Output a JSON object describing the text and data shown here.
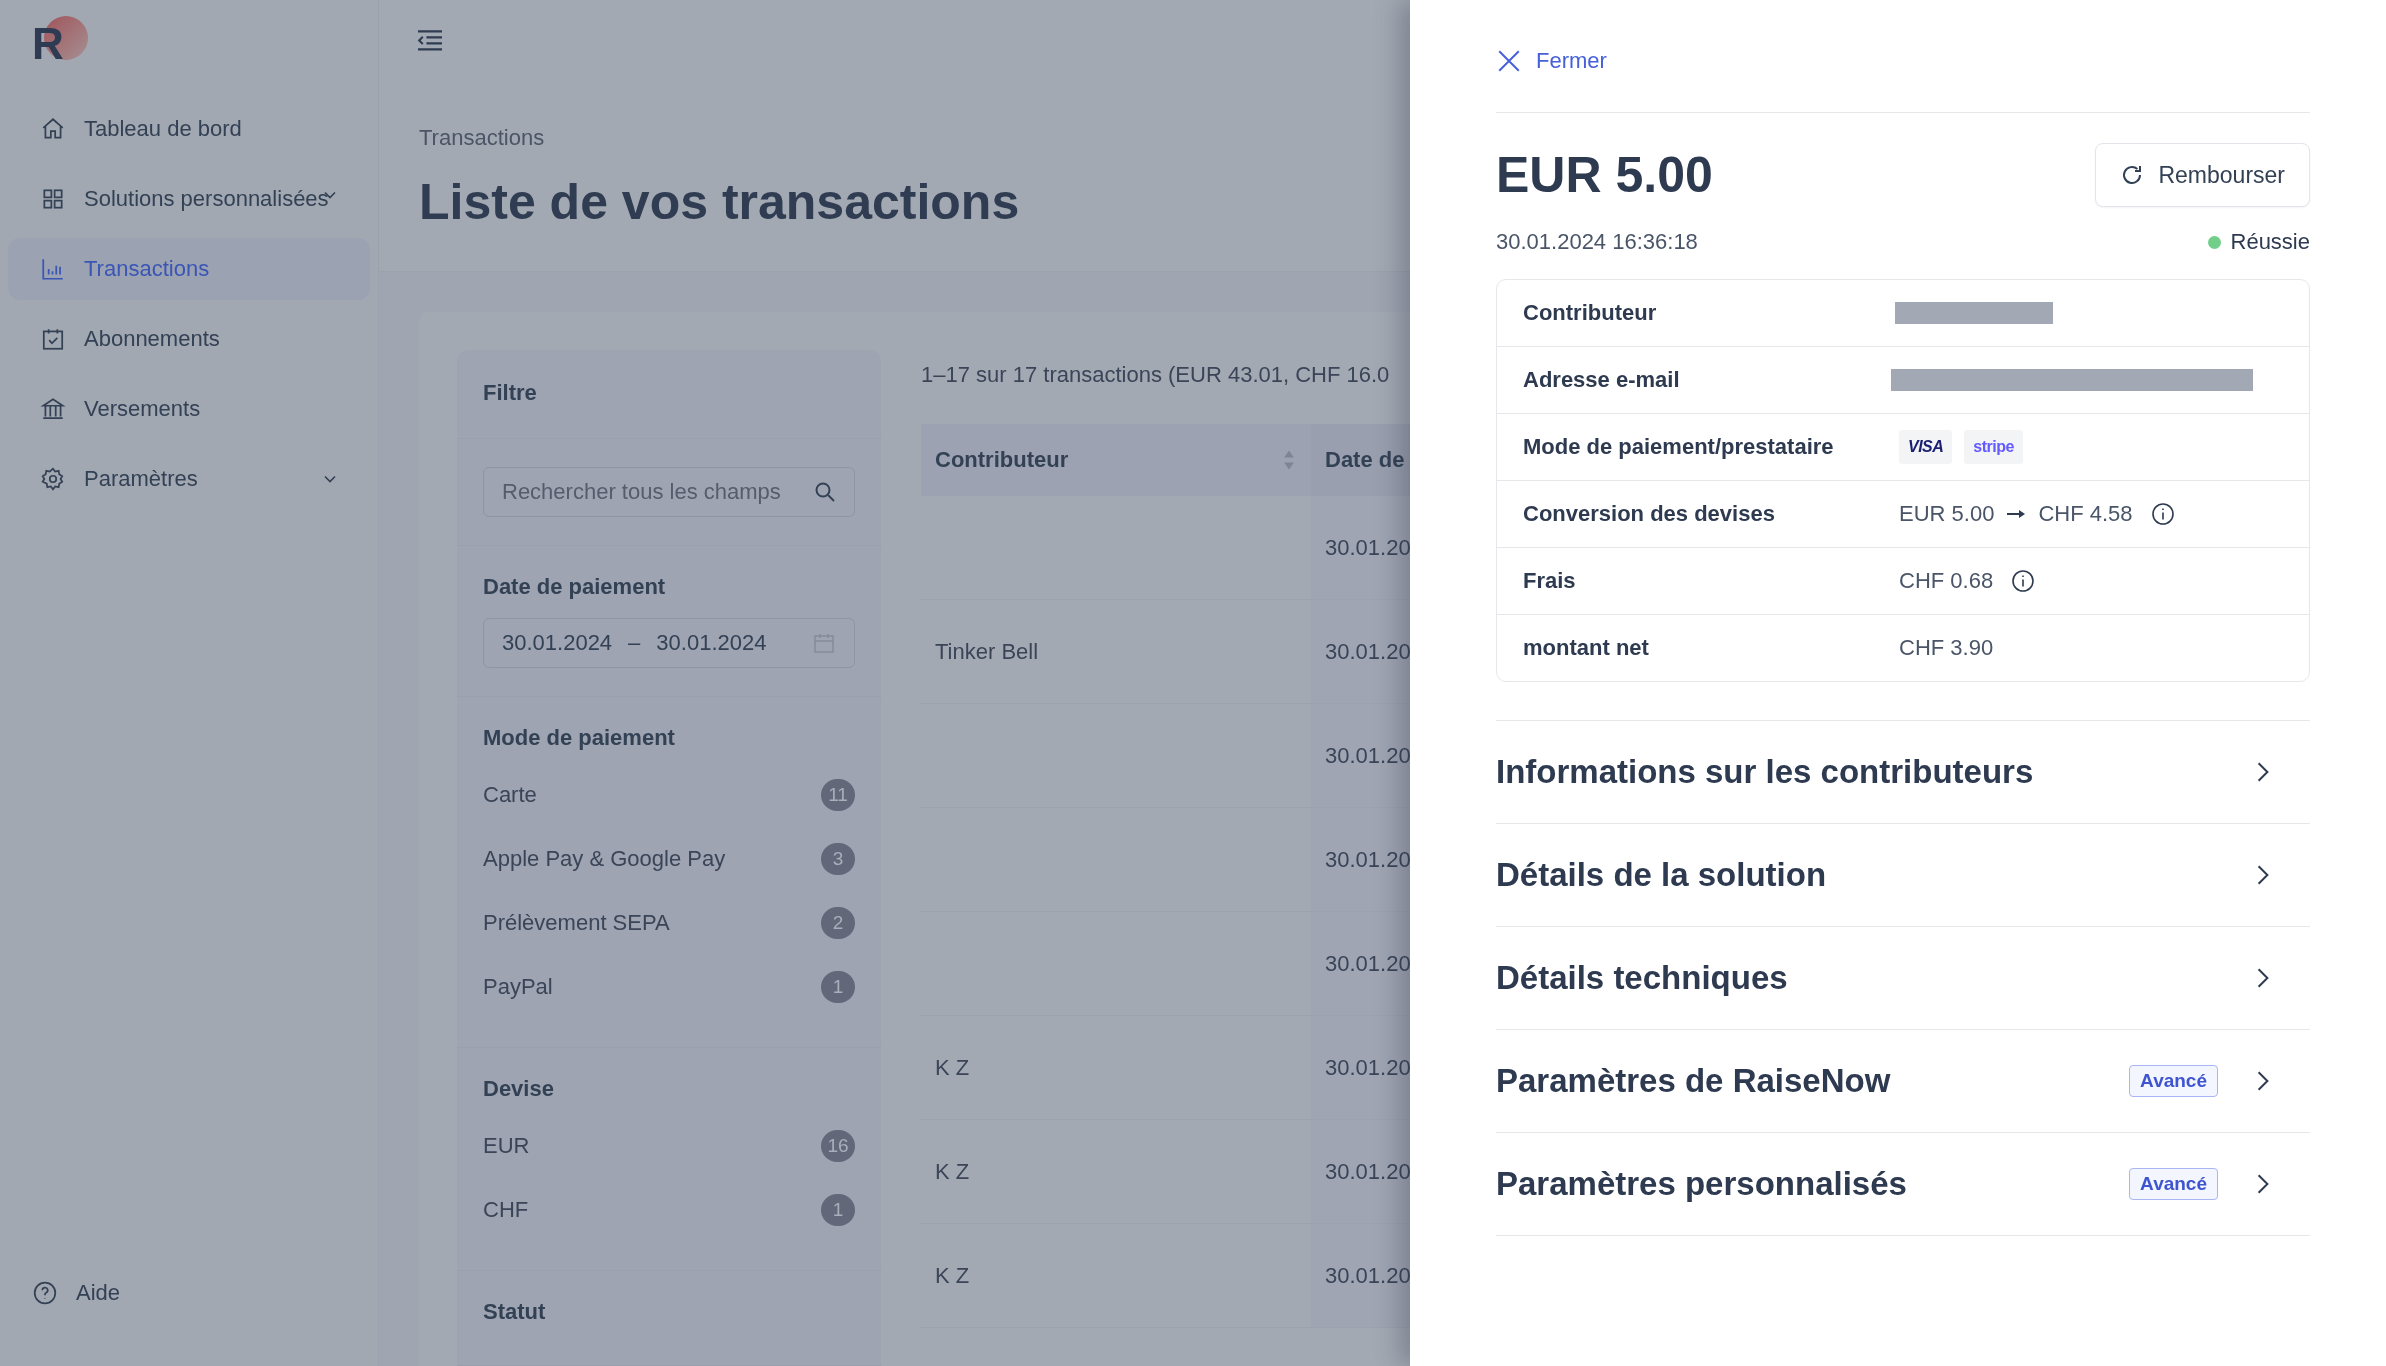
{
  "logo": {
    "letter": "R"
  },
  "sidebar": {
    "items": [
      {
        "label": "Tableau de bord",
        "selected": false,
        "expandable": false
      },
      {
        "label": "Solutions personnalisées",
        "selected": false,
        "expandable": true
      },
      {
        "label": "Transactions",
        "selected": true,
        "expandable": false
      },
      {
        "label": "Abonnements",
        "selected": false,
        "expandable": false
      },
      {
        "label": "Versements",
        "selected": false,
        "expandable": false
      },
      {
        "label": "Paramètres",
        "selected": false,
        "expandable": true
      }
    ],
    "help": "Aide"
  },
  "breadcrumb": "Transactions",
  "page_title": "Liste de vos transactions",
  "filter": {
    "title": "Filtre",
    "search": {
      "placeholder": "Rechercher tous les champs"
    },
    "date": {
      "title": "Date de paiement",
      "from": "30.01.2024",
      "separator": "–",
      "to": "30.01.2024"
    },
    "groups": [
      {
        "title": "Mode de paiement",
        "options": [
          {
            "label": "Carte",
            "count": "11"
          },
          {
            "label": "Apple Pay & Google Pay",
            "count": "3"
          },
          {
            "label": "Prélèvement SEPA",
            "count": "2"
          },
          {
            "label": "PayPal",
            "count": "1"
          }
        ]
      },
      {
        "title": "Devise",
        "options": [
          {
            "label": "EUR",
            "count": "16"
          },
          {
            "label": "CHF",
            "count": "1"
          }
        ]
      },
      {
        "title": "Statut"
      }
    ]
  },
  "table": {
    "summary": "1–17 sur 17 transactions (EUR 43.01, CHF 16.0",
    "columns": [
      "Contributeur",
      "Date de"
    ],
    "rows": [
      {
        "date": "30.01.20"
      },
      {
        "contributor": "Tinker Bell",
        "date": "30.01.20"
      },
      {
        "date": "30.01.20"
      },
      {
        "date": "30.01.20"
      },
      {
        "date": "30.01.20"
      },
      {
        "contributor": "K Z",
        "date": "30.01.20"
      },
      {
        "contributor": "K Z",
        "date": "30.01.20"
      },
      {
        "contributor": "K Z",
        "date": "30.01.20"
      }
    ]
  },
  "drawer": {
    "close": "Fermer",
    "amount": "EUR 5.00",
    "refund": "Rembourser",
    "datetime": "30.01.2024 16:36:18",
    "status": {
      "label": "Réussie",
      "color": "#72cf8a"
    },
    "details": [
      {
        "label": "Contributeur",
        "kind": "redacted"
      },
      {
        "label": "Adresse e-mail",
        "kind": "redacted_long"
      },
      {
        "label": "Mode de paiement/prestataire",
        "kind": "logos",
        "logos": [
          "VISA",
          "stripe"
        ]
      },
      {
        "label": "Conversion des devises",
        "kind": "conversion",
        "from": "EUR 5.00",
        "to": "CHF 4.58"
      },
      {
        "label": "Frais",
        "kind": "info",
        "value": "CHF 0.68"
      },
      {
        "label": "montant net",
        "kind": "text",
        "value": "CHF 3.90"
      }
    ],
    "sections": [
      {
        "title": "Informations sur les contributeurs"
      },
      {
        "title": "Détails de la solution"
      },
      {
        "title": "Détails techniques"
      },
      {
        "title": "Paramètres de RaiseNow",
        "badge": "Avancé"
      },
      {
        "title": "Paramètres personnalisés",
        "badge": "Avancé"
      }
    ]
  }
}
